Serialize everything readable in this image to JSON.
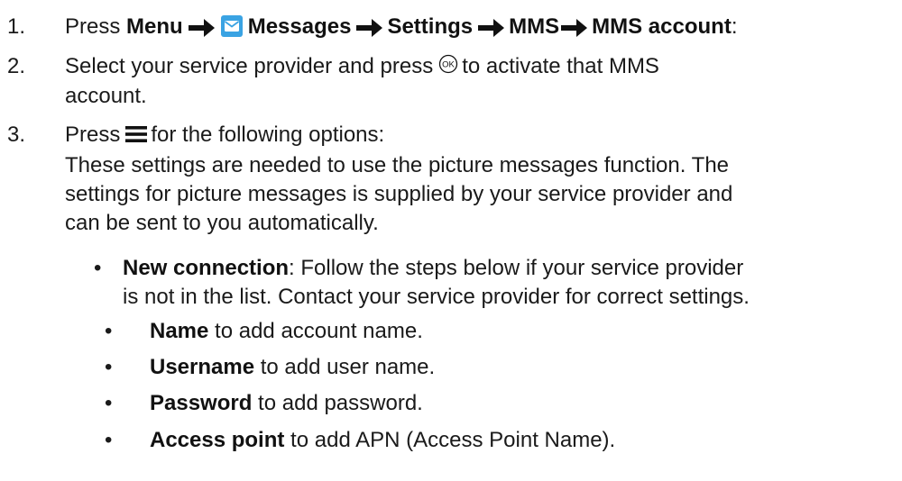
{
  "steps": [
    {
      "number": "1.",
      "press": "Press",
      "menu": "Menu",
      "messages": "Messages",
      "settings": "Settings",
      "mms": "MMS",
      "mms_account": "MMS account",
      "colon": ":",
      "icons": {
        "arrow": "right-arrow-icon",
        "messages": "envelope-icon"
      },
      "colors": {
        "envelope_bg": "#3aa3e3"
      }
    },
    {
      "number": "2.",
      "text_before": "Select your service provider and press",
      "text_after": "to activate that MMS",
      "text_line2": "account.",
      "icons": {
        "ok": "ok-button-icon"
      }
    },
    {
      "number": "3.",
      "press": "Press",
      "text_after": "for the following options:",
      "para_line1": "These settings are needed to use the picture messages function. The",
      "para_line2": "settings for picture messages is supplied by your service provider and",
      "para_line3": "can be sent to you automatically.",
      "icons": {
        "menu": "hamburger-menu-icon"
      }
    }
  ],
  "options": {
    "new_connection": {
      "bullet": "•",
      "label": "New connection",
      "text_line1": ": Follow the steps below if your service provider",
      "text_line2": "is not in the list. Contact your service provider for correct settings."
    },
    "sub_items": [
      {
        "bullet": "•",
        "label": "Name",
        "text": " to add account name."
      },
      {
        "bullet": "•",
        "label": "Username",
        "text": " to add user name."
      },
      {
        "bullet": "•",
        "label": "Password",
        "text": " to add password."
      },
      {
        "bullet": "•",
        "label": "Access point",
        "text": " to add APN (Access Point Name)."
      }
    ]
  }
}
